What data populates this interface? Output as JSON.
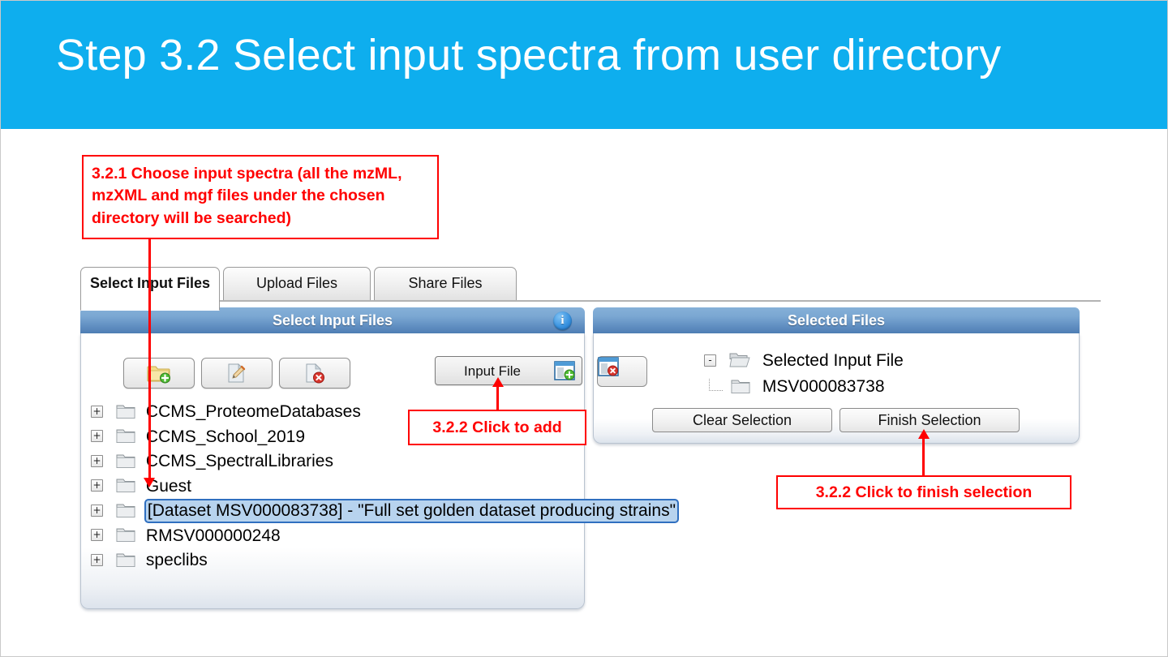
{
  "banner": {
    "title": "Step 3.2 Select input spectra from user directory",
    "background": "#0eaeee",
    "text_color": "#ffffff"
  },
  "annotations": {
    "accent_color": "#ff0000",
    "callout_1": "3.2.1 Choose input spectra (all the mzML, mzXML and mgf files under the chosen directory will be searched)",
    "callout_2": "3.2.2 Click to add",
    "callout_3": "3.2.2 Click to finish selection"
  },
  "tabs": [
    {
      "label": "Select Input Files",
      "active": true
    },
    {
      "label": "Upload Files",
      "active": false
    },
    {
      "label": "Share Files",
      "active": false
    }
  ],
  "left_panel": {
    "header": "Select Input Files",
    "info_badge": "i",
    "toolbar": {
      "new_folder_label": "",
      "edit_label": "",
      "delete_label": "",
      "input_file_label": "Input File"
    },
    "tree": [
      {
        "label": "CCMS_ProteomeDatabases",
        "expander": "+",
        "selected": false
      },
      {
        "label": "CCMS_School_2019",
        "expander": "+",
        "selected": false
      },
      {
        "label": "CCMS_SpectralLibraries",
        "expander": "+",
        "selected": false
      },
      {
        "label": "Guest",
        "expander": "+",
        "selected": false
      },
      {
        "label": "[Dataset MSV000083738] - \"Full set golden dataset producing strains\"",
        "expander": "+",
        "selected": true
      },
      {
        "label": "RMSV000000248",
        "expander": "+",
        "selected": false
      },
      {
        "label": "speclibs",
        "expander": "+",
        "selected": false
      }
    ]
  },
  "right_panel": {
    "header": "Selected Files",
    "tree": {
      "root_label": "Selected Input File",
      "root_expander": "-",
      "child_label": "MSV000083738"
    },
    "buttons": {
      "clear": "Clear Selection",
      "finish": "Finish Selection"
    }
  },
  "colors": {
    "panel_header_top": "#86b0d8",
    "panel_header_bottom": "#4e7eb4",
    "tree_selected_fill": "#b7d3ee",
    "tree_selected_border": "#2f6fc0"
  }
}
